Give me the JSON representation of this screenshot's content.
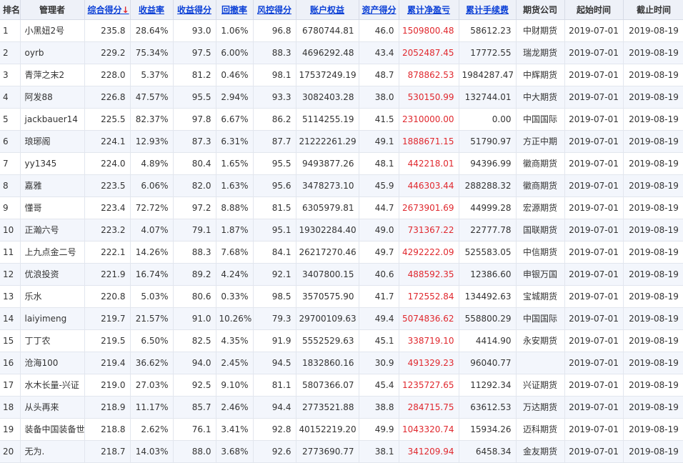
{
  "headers": [
    {
      "key": "rank",
      "label": "排名",
      "sortable": false
    },
    {
      "key": "manager",
      "label": "管理者",
      "sortable": false
    },
    {
      "key": "total_score",
      "label": "综合得分",
      "sortable": true,
      "arrow": "↓"
    },
    {
      "key": "return_rate",
      "label": "收益率",
      "sortable": true
    },
    {
      "key": "return_score",
      "label": "收益得分",
      "sortable": true
    },
    {
      "key": "drawdown",
      "label": "回撤率",
      "sortable": true
    },
    {
      "key": "risk_score",
      "label": "风控得分",
      "sortable": true
    },
    {
      "key": "equity",
      "label": "账户权益",
      "sortable": true
    },
    {
      "key": "asset_score",
      "label": "资产得分",
      "sortable": true
    },
    {
      "key": "net_pnl",
      "label": "累计净盈亏",
      "sortable": true
    },
    {
      "key": "fees",
      "label": "累计手续费",
      "sortable": true
    },
    {
      "key": "broker",
      "label": "期货公司",
      "sortable": false
    },
    {
      "key": "start",
      "label": "起始时间",
      "sortable": false
    },
    {
      "key": "end",
      "label": "截止时间",
      "sortable": false
    }
  ],
  "rows": [
    [
      "1",
      "小黑妞2号",
      "235.8",
      "28.64%",
      "93.0",
      "1.06%",
      "96.8",
      "6780744.81",
      "46.0",
      "1509800.48",
      "58612.23",
      "中财期货",
      "2019-07-01",
      "2019-08-19"
    ],
    [
      "2",
      "oyrb",
      "229.2",
      "75.34%",
      "97.5",
      "6.00%",
      "88.3",
      "4696292.48",
      "43.4",
      "2052487.45",
      "17772.55",
      "瑞龙期货",
      "2019-07-01",
      "2019-08-19"
    ],
    [
      "3",
      "青萍之末2",
      "228.0",
      "5.37%",
      "81.2",
      "0.46%",
      "98.1",
      "17537249.19",
      "48.7",
      "878862.53",
      "1984287.47",
      "中辉期货",
      "2019-07-01",
      "2019-08-19"
    ],
    [
      "4",
      "阿发88",
      "226.8",
      "47.57%",
      "95.5",
      "2.94%",
      "93.3",
      "3082403.28",
      "38.0",
      "530150.99",
      "132744.01",
      "中大期货",
      "2019-07-01",
      "2019-08-19"
    ],
    [
      "5",
      "jackbauer14",
      "225.5",
      "82.37%",
      "97.8",
      "6.67%",
      "86.2",
      "5114255.19",
      "41.5",
      "2310000.00",
      "0.00",
      "中国国际",
      "2019-07-01",
      "2019-08-19"
    ],
    [
      "6",
      "琅琊阁",
      "224.1",
      "12.93%",
      "87.3",
      "6.31%",
      "87.7",
      "21222261.29",
      "49.1",
      "1888671.15",
      "51790.97",
      "方正中期",
      "2019-07-01",
      "2019-08-19"
    ],
    [
      "7",
      "yy1345",
      "224.0",
      "4.89%",
      "80.4",
      "1.65%",
      "95.5",
      "9493877.26",
      "48.1",
      "442218.01",
      "94396.99",
      "徽商期货",
      "2019-07-01",
      "2019-08-19"
    ],
    [
      "8",
      "嘉雅",
      "223.5",
      "6.06%",
      "82.0",
      "1.63%",
      "95.6",
      "3478273.10",
      "45.9",
      "446303.44",
      "288288.32",
      "徽商期货",
      "2019-07-01",
      "2019-08-19"
    ],
    [
      "9",
      "懂哥",
      "223.4",
      "72.72%",
      "97.2",
      "8.88%",
      "81.5",
      "6305979.81",
      "44.7",
      "2673901.69",
      "44999.28",
      "宏源期货",
      "2019-07-01",
      "2019-08-19"
    ],
    [
      "10",
      "正瀚六号",
      "223.2",
      "4.07%",
      "79.1",
      "1.87%",
      "95.1",
      "19302284.40",
      "49.0",
      "731367.22",
      "22777.78",
      "国联期货",
      "2019-07-01",
      "2019-08-19"
    ],
    [
      "11",
      "上九点金二号",
      "222.1",
      "14.26%",
      "88.3",
      "7.68%",
      "84.1",
      "26217270.46",
      "49.7",
      "4292222.09",
      "525583.05",
      "中信期货",
      "2019-07-01",
      "2019-08-19"
    ],
    [
      "12",
      "优浪投资",
      "221.9",
      "16.74%",
      "89.2",
      "4.24%",
      "92.1",
      "3407800.15",
      "40.6",
      "488592.35",
      "12386.60",
      "申银万国",
      "2019-07-01",
      "2019-08-19"
    ],
    [
      "13",
      "乐水",
      "220.8",
      "5.03%",
      "80.6",
      "0.33%",
      "98.5",
      "3570575.90",
      "41.7",
      "172552.84",
      "134492.63",
      "宝城期货",
      "2019-07-01",
      "2019-08-19"
    ],
    [
      "14",
      "laiyimeng",
      "219.7",
      "21.57%",
      "91.0",
      "10.26%",
      "79.3",
      "29700109.63",
      "49.4",
      "5074836.62",
      "558800.29",
      "中国国际",
      "2019-07-01",
      "2019-08-19"
    ],
    [
      "15",
      "丁丁农",
      "219.5",
      "6.50%",
      "82.5",
      "4.35%",
      "91.9",
      "5552529.63",
      "45.1",
      "338719.10",
      "4414.90",
      "永安期货",
      "2019-07-01",
      "2019-08-19"
    ],
    [
      "16",
      "沧海100",
      "219.4",
      "36.62%",
      "94.0",
      "2.45%",
      "94.5",
      "1832860.16",
      "30.9",
      "491329.23",
      "96040.77",
      "",
      "2019-07-01",
      "2019-08-19"
    ],
    [
      "17",
      "水木长量-兴证",
      "219.0",
      "27.03%",
      "92.5",
      "9.10%",
      "81.1",
      "5807366.07",
      "45.4",
      "1235727.65",
      "11292.34",
      "兴证期货",
      "2019-07-01",
      "2019-08-19"
    ],
    [
      "18",
      "从头再来",
      "218.9",
      "11.17%",
      "85.7",
      "2.46%",
      "94.4",
      "2773521.88",
      "38.8",
      "284715.75",
      "63612.53",
      "万达期货",
      "2019-07-01",
      "2019-08-19"
    ],
    [
      "19",
      "装备中国装备世",
      "218.8",
      "2.62%",
      "76.1",
      "3.41%",
      "92.8",
      "40152219.20",
      "49.9",
      "1043320.74",
      "15934.26",
      "迈科期货",
      "2019-07-01",
      "2019-08-19"
    ],
    [
      "20",
      "无为.",
      "218.7",
      "14.03%",
      "88.0",
      "3.68%",
      "92.6",
      "2773690.77",
      "38.1",
      "341209.94",
      "6458.34",
      "金友期货",
      "2019-07-01",
      "2019-08-19"
    ]
  ]
}
